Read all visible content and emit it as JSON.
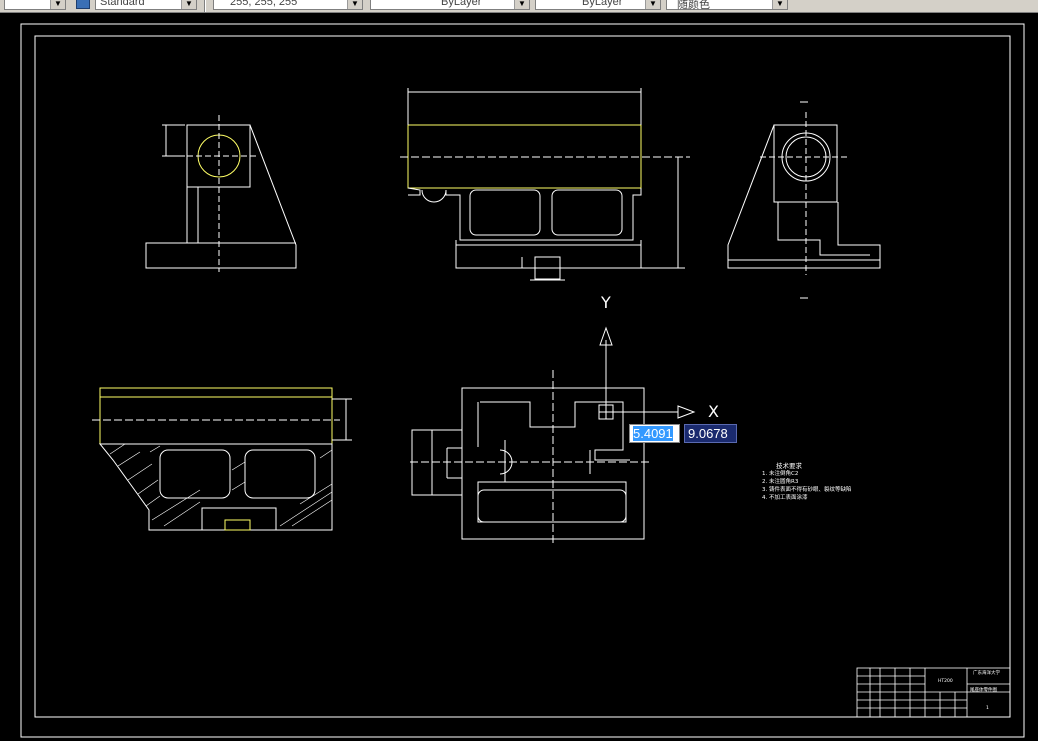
{
  "toolbar": {
    "text_style": "Standard",
    "color": "255, 255, 255",
    "linetype": "ByLayer",
    "lineweight": "ByLayer",
    "plot_color": "随颜色"
  },
  "ucs_icon": {
    "x_label": "X",
    "y_label": "Y"
  },
  "dynamic_input": {
    "x_value": "5.4091",
    "y_value": "9.0678"
  },
  "tech_requirements": {
    "title": "技术要求",
    "items": [
      "1. 未注倒角C2",
      "2. 未注圆角R3",
      "3. 铸件表面不得有砂眼、裂纹等缺陷",
      "4. 不加工表面涂漆"
    ]
  },
  "title_block": {
    "material": "HT200",
    "company": "广东海洋大学",
    "drawing_name": "尾座体零件图",
    "sheet": "1"
  },
  "colors": {
    "background": "#000000",
    "line": "#ffffff",
    "highlight": "#ffff66",
    "selection": "#3399ff"
  }
}
